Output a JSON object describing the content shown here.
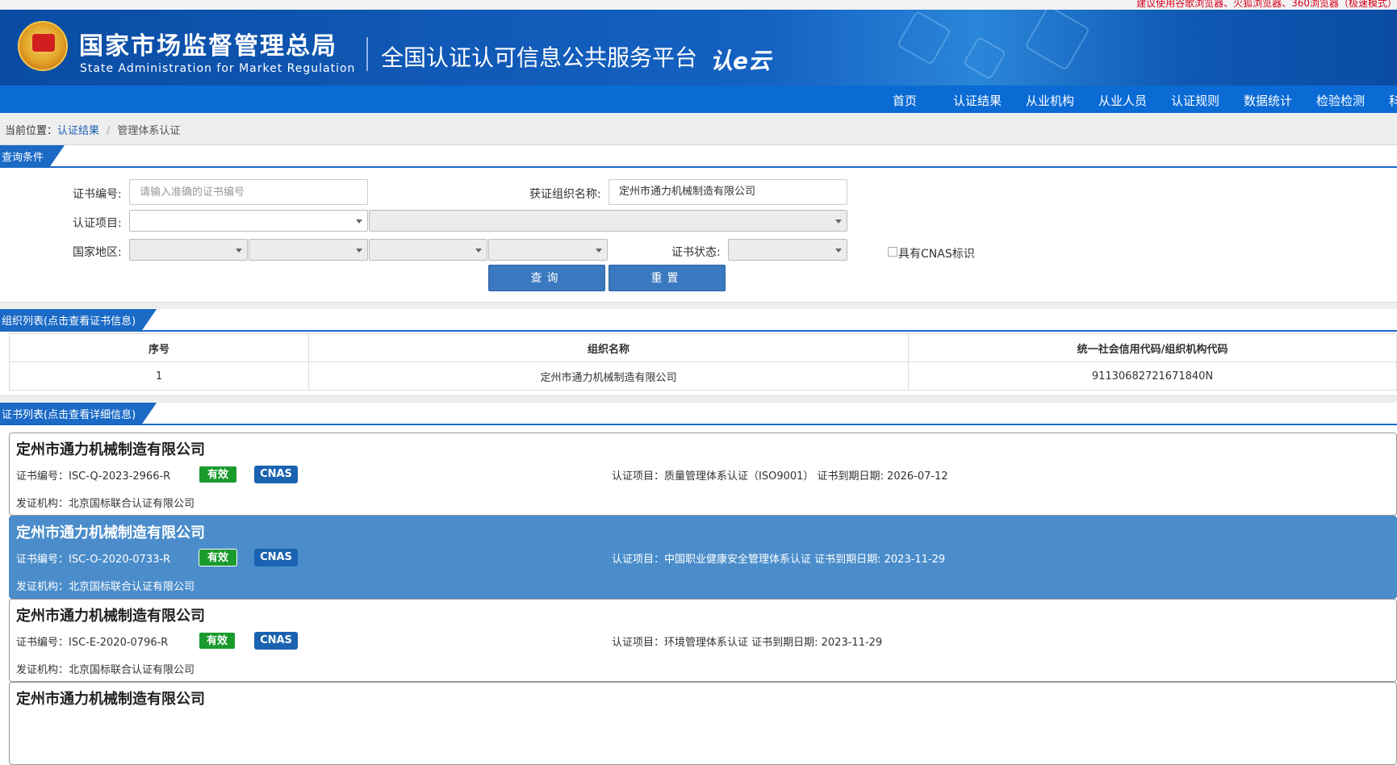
{
  "topbar": {
    "notice": "建议使用谷歌浏览器、火狐浏览器、360浏览器（极速模式）"
  },
  "header": {
    "org_cn": "国家市场监督管理总局",
    "org_en": "State Administration for Market Regulation",
    "platform": "全国认证认可信息公共服务平台",
    "logo_text": "认e云"
  },
  "nav": {
    "items": [
      "首页",
      "认证结果",
      "从业机构",
      "从业人员",
      "认证规则",
      "数据统计",
      "检验检测",
      "科"
    ]
  },
  "breadcrumb": {
    "label": "当前位置：",
    "link": "认证结果",
    "sep": "/",
    "current": "管理体系认证"
  },
  "query": {
    "section_title": "查询条件",
    "cert_no_label": "证书编号:",
    "cert_no_placeholder": "请输入准确的证书编号",
    "org_name_label": "获证组织名称:",
    "org_name_value": "定州市通力机械制造有限公司",
    "project_label": "认证项目:",
    "region_label": "国家地区:",
    "status_label": "证书状态:",
    "cnas_label": "具有CNAS标识",
    "search_btn": "查询",
    "reset_btn": "重置"
  },
  "orgs": {
    "section_title": "组织列表(点击查看证书信息)",
    "headers": [
      "序号",
      "组织名称",
      "统一社会信用代码/组织机构代码"
    ],
    "rows": [
      {
        "idx": "1",
        "name": "定州市通力机械制造有限公司",
        "code": "91130682721671840N"
      }
    ]
  },
  "certs": {
    "section_title": "证书列表(点击查看详细信息)",
    "items": [
      {
        "name": "定州市通力机械制造有限公司",
        "cert_no": "证书编号：ISC-Q-2023-2966-R",
        "status": "有效",
        "cnas": "CNAS",
        "project": "认证项目：质量管理体系认证（ISO9001）   证书到期日期: 2026-07-12",
        "issuer": "发证机构：北京国标联合认证有限公司"
      },
      {
        "name": "定州市通力机械制造有限公司",
        "cert_no": "证书编号：ISC-O-2020-0733-R",
        "status": "有效",
        "cnas": "CNAS",
        "project": "认证项目：中国职业健康安全管理体系认证   证书到期日期: 2023-11-29",
        "issuer": "发证机构：北京国标联合认证有限公司"
      },
      {
        "name": "定州市通力机械制造有限公司",
        "cert_no": "证书编号：ISC-E-2020-0796-R",
        "status": "有效",
        "cnas": "CNAS",
        "project": "认证项目：环境管理体系认证   证书到期日期: 2023-11-29",
        "issuer": "发证机构：北京国标联合认证有限公司"
      },
      {
        "name": "定州市通力机械制造有限公司"
      }
    ]
  }
}
